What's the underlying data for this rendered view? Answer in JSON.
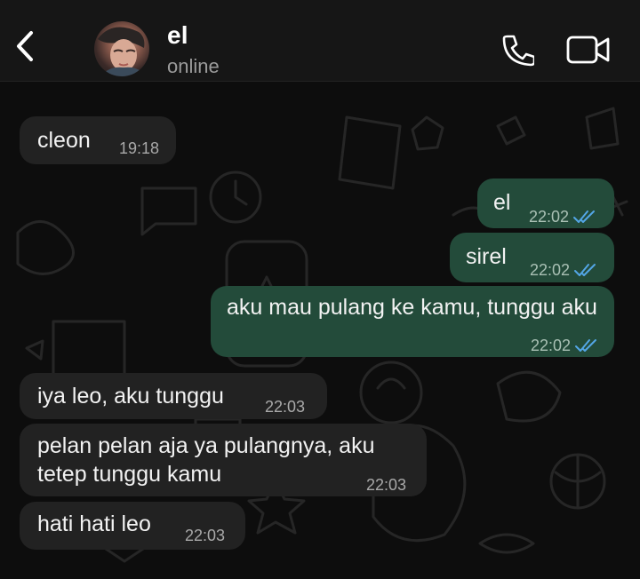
{
  "header": {
    "contact_name": "el",
    "status": "online",
    "icons": {
      "back": "chevron-left-icon",
      "call": "phone-icon",
      "video": "video-camera-icon"
    }
  },
  "messages": [
    {
      "direction": "incoming",
      "text": "cleon",
      "time": "19:18"
    },
    {
      "direction": "outgoing",
      "text": "el",
      "time": "22:02",
      "status": "read"
    },
    {
      "direction": "outgoing",
      "text": "sirel",
      "time": "22:02",
      "status": "read"
    },
    {
      "direction": "outgoing",
      "text": "aku mau pulang ke kamu, tunggu aku",
      "time": "22:02",
      "status": "read"
    },
    {
      "direction": "incoming",
      "text": "iya leo, aku tunggu",
      "time": "22:03"
    },
    {
      "direction": "incoming",
      "text": "pelan pelan aja ya pulangnya, aku tetep tunggu kamu",
      "time": "22:03"
    },
    {
      "direction": "incoming",
      "text": "hati hati leo",
      "time": "22:03"
    }
  ],
  "colors": {
    "background": "#0d0d0d",
    "incoming_bubble": "#222222",
    "outgoing_bubble": "#234b3a",
    "read_ticks": "#53a6e6"
  }
}
